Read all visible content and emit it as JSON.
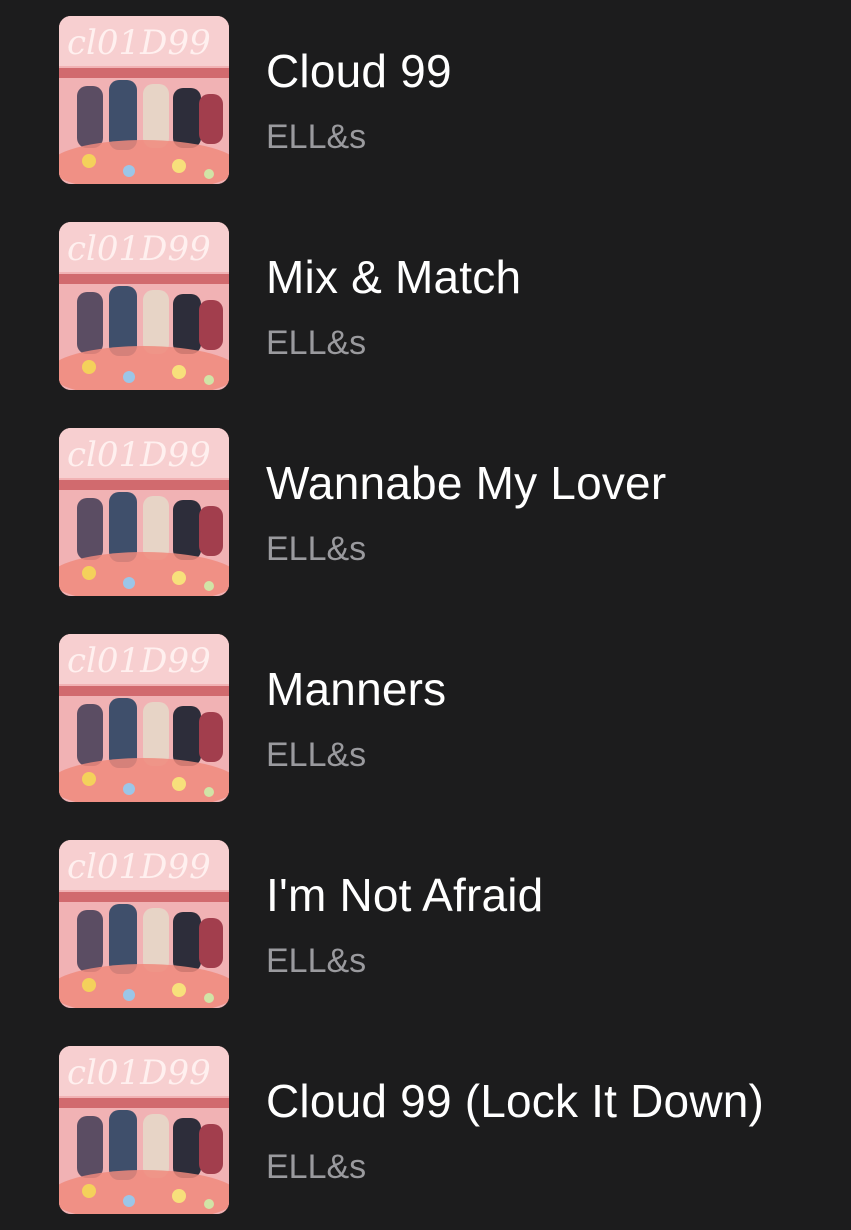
{
  "colors": {
    "background": "#1c1c1d",
    "title": "#ffffff",
    "artist": "#9a9a9e",
    "artwork_base": "#ec9a9a"
  },
  "artwork_icon": "album-artwork-cloud-99",
  "tracks": [
    {
      "title": "Cloud 99",
      "artist": "ELL&s"
    },
    {
      "title": "Mix & Match",
      "artist": "ELL&s"
    },
    {
      "title": "Wannabe My Lover",
      "artist": "ELL&s"
    },
    {
      "title": "Manners",
      "artist": "ELL&s"
    },
    {
      "title": "I'm Not Afraid",
      "artist": "ELL&s"
    },
    {
      "title": "Cloud 99 (Lock It Down)",
      "artist": "ELL&s"
    }
  ]
}
